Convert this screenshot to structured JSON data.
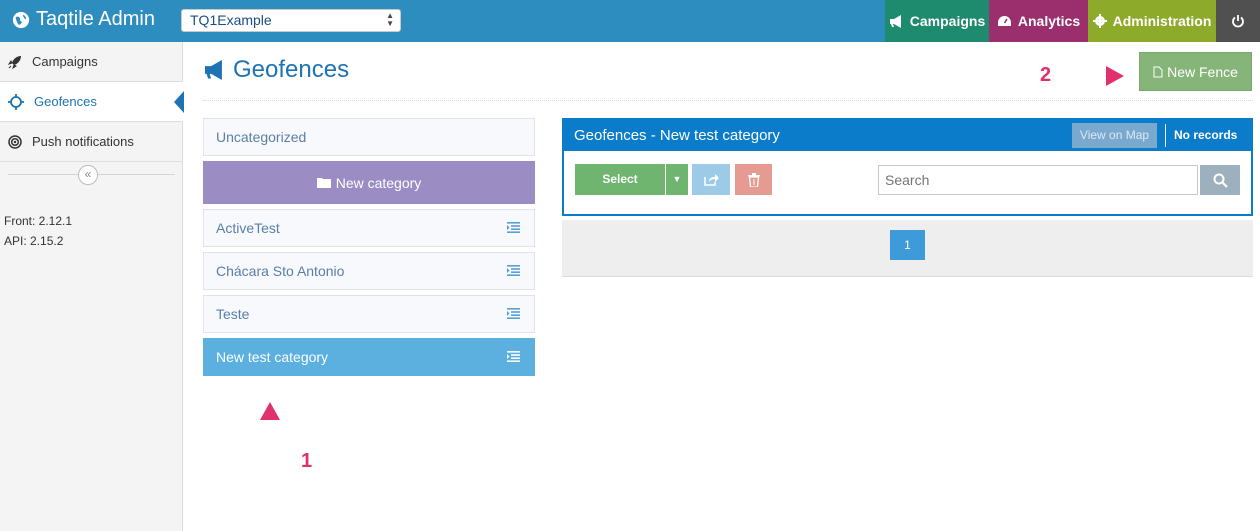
{
  "topbar": {
    "brand": "Taqtile Admin",
    "app_selector_value": "TQ1Example",
    "nav": {
      "campaigns": "Campaigns",
      "analytics": "Analytics",
      "administration": "Administration"
    },
    "colors": {
      "bar": "#2e8dbf",
      "campaigns": "#1e8a6e",
      "analytics": "#9b2f6e",
      "administration": "#8eaa2b",
      "power": "#505050"
    }
  },
  "sidebar": {
    "items": [
      {
        "label": "Campaigns",
        "icon": "rocket-icon"
      },
      {
        "label": "Geofences",
        "icon": "crosshair-icon",
        "active": true
      },
      {
        "label": "Push notifications",
        "icon": "target-icon"
      }
    ],
    "front_version": "Front: 2.12.1",
    "api_version": "API: 2.15.2"
  },
  "page": {
    "title": "Geofences",
    "new_fence_label": "New Fence"
  },
  "categories": {
    "uncategorized": "Uncategorized",
    "new_category_label": "New category",
    "items": [
      {
        "label": "ActiveTest"
      },
      {
        "label": "Chácara Sto Antonio"
      },
      {
        "label": "Teste"
      },
      {
        "label": "New test category",
        "selected": true
      }
    ]
  },
  "panel": {
    "title": "Geofences - New test category",
    "view_on_map": "View on Map",
    "records": "No records",
    "select_label": "Select",
    "search_placeholder": "Search",
    "pages": [
      "1"
    ]
  },
  "annotations": {
    "one": "1",
    "two": "2",
    "color": "#e0306e"
  }
}
